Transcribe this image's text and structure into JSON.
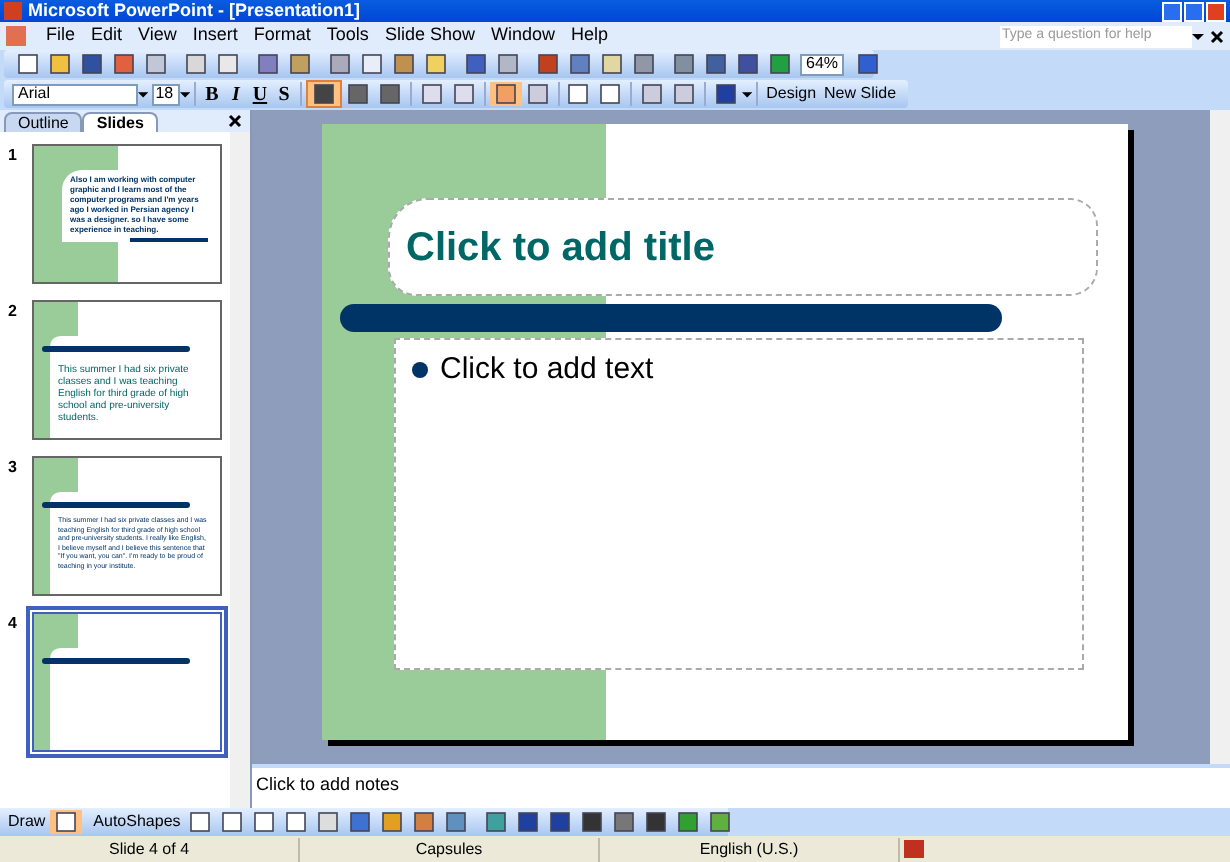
{
  "window": {
    "title": "Microsoft PowerPoint - [Presentation1]"
  },
  "menu": [
    "File",
    "Edit",
    "View",
    "Insert",
    "Format",
    "Tools",
    "Slide Show",
    "Window",
    "Help"
  ],
  "help_search": {
    "placeholder": "Type a question for help"
  },
  "zoom": "64%",
  "formatting": {
    "font": "Arial",
    "size": "18",
    "style_buttons": [
      "B",
      "I",
      "U",
      "S"
    ],
    "design": "Design",
    "new_slide": "New Slide"
  },
  "pane_tabs": [
    {
      "label": "Outline",
      "selected": false
    },
    {
      "label": "Slides",
      "selected": true
    }
  ],
  "slides": [
    {
      "number": "1",
      "kind": "full",
      "selected": false,
      "text": "Also I am working with computer graphic and I learn most of the computer programs and I'm years ago I worked in Persian agency I was a designer. so I have some experience in teaching."
    },
    {
      "number": "2",
      "kind": "title",
      "selected": false,
      "text": "This summer I had six private classes and I was teaching English for third grade of high school and pre-university students."
    },
    {
      "number": "3",
      "kind": "bullet",
      "selected": false,
      "text": "This summer I had six private classes and I was teaching English for third grade of high school and pre-university students. I really like English, I believe myself and I believe this sentence that \"If you want, you can\". I'm ready to be proud of teaching in your institute."
    },
    {
      "number": "4",
      "kind": "bullet",
      "selected": true
    }
  ],
  "slide": {
    "title_placeholder": "Click to add title",
    "body_placeholder": "Click to add text"
  },
  "notes": {
    "placeholder": "Click to add notes"
  },
  "drawing_toolbar": {
    "draw": "Draw",
    "autoshapes": "AutoShapes"
  },
  "status_bar": [
    "Slide 4 of 4",
    "Capsules",
    "English (U.S.)"
  ]
}
